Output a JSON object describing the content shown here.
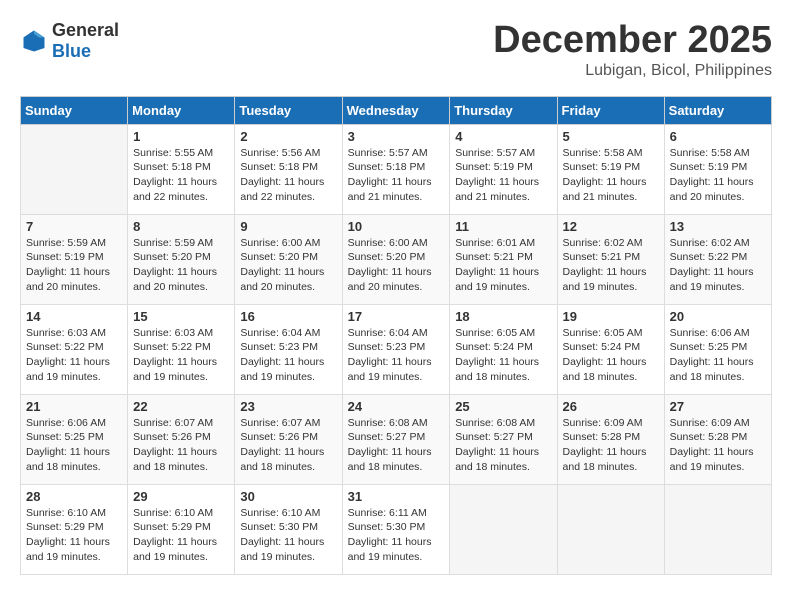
{
  "logo": {
    "general": "General",
    "blue": "Blue"
  },
  "header": {
    "month": "December 2025",
    "location": "Lubigan, Bicol, Philippines"
  },
  "weekdays": [
    "Sunday",
    "Monday",
    "Tuesday",
    "Wednesday",
    "Thursday",
    "Friday",
    "Saturday"
  ],
  "weeks": [
    [
      {
        "day": "",
        "info": ""
      },
      {
        "day": "1",
        "info": "Sunrise: 5:55 AM\nSunset: 5:18 PM\nDaylight: 11 hours\nand 22 minutes."
      },
      {
        "day": "2",
        "info": "Sunrise: 5:56 AM\nSunset: 5:18 PM\nDaylight: 11 hours\nand 22 minutes."
      },
      {
        "day": "3",
        "info": "Sunrise: 5:57 AM\nSunset: 5:18 PM\nDaylight: 11 hours\nand 21 minutes."
      },
      {
        "day": "4",
        "info": "Sunrise: 5:57 AM\nSunset: 5:19 PM\nDaylight: 11 hours\nand 21 minutes."
      },
      {
        "day": "5",
        "info": "Sunrise: 5:58 AM\nSunset: 5:19 PM\nDaylight: 11 hours\nand 21 minutes."
      },
      {
        "day": "6",
        "info": "Sunrise: 5:58 AM\nSunset: 5:19 PM\nDaylight: 11 hours\nand 20 minutes."
      }
    ],
    [
      {
        "day": "7",
        "info": "Sunrise: 5:59 AM\nSunset: 5:19 PM\nDaylight: 11 hours\nand 20 minutes."
      },
      {
        "day": "8",
        "info": "Sunrise: 5:59 AM\nSunset: 5:20 PM\nDaylight: 11 hours\nand 20 minutes."
      },
      {
        "day": "9",
        "info": "Sunrise: 6:00 AM\nSunset: 5:20 PM\nDaylight: 11 hours\nand 20 minutes."
      },
      {
        "day": "10",
        "info": "Sunrise: 6:00 AM\nSunset: 5:20 PM\nDaylight: 11 hours\nand 20 minutes."
      },
      {
        "day": "11",
        "info": "Sunrise: 6:01 AM\nSunset: 5:21 PM\nDaylight: 11 hours\nand 19 minutes."
      },
      {
        "day": "12",
        "info": "Sunrise: 6:02 AM\nSunset: 5:21 PM\nDaylight: 11 hours\nand 19 minutes."
      },
      {
        "day": "13",
        "info": "Sunrise: 6:02 AM\nSunset: 5:22 PM\nDaylight: 11 hours\nand 19 minutes."
      }
    ],
    [
      {
        "day": "14",
        "info": "Sunrise: 6:03 AM\nSunset: 5:22 PM\nDaylight: 11 hours\nand 19 minutes."
      },
      {
        "day": "15",
        "info": "Sunrise: 6:03 AM\nSunset: 5:22 PM\nDaylight: 11 hours\nand 19 minutes."
      },
      {
        "day": "16",
        "info": "Sunrise: 6:04 AM\nSunset: 5:23 PM\nDaylight: 11 hours\nand 19 minutes."
      },
      {
        "day": "17",
        "info": "Sunrise: 6:04 AM\nSunset: 5:23 PM\nDaylight: 11 hours\nand 19 minutes."
      },
      {
        "day": "18",
        "info": "Sunrise: 6:05 AM\nSunset: 5:24 PM\nDaylight: 11 hours\nand 18 minutes."
      },
      {
        "day": "19",
        "info": "Sunrise: 6:05 AM\nSunset: 5:24 PM\nDaylight: 11 hours\nand 18 minutes."
      },
      {
        "day": "20",
        "info": "Sunrise: 6:06 AM\nSunset: 5:25 PM\nDaylight: 11 hours\nand 18 minutes."
      }
    ],
    [
      {
        "day": "21",
        "info": "Sunrise: 6:06 AM\nSunset: 5:25 PM\nDaylight: 11 hours\nand 18 minutes."
      },
      {
        "day": "22",
        "info": "Sunrise: 6:07 AM\nSunset: 5:26 PM\nDaylight: 11 hours\nand 18 minutes."
      },
      {
        "day": "23",
        "info": "Sunrise: 6:07 AM\nSunset: 5:26 PM\nDaylight: 11 hours\nand 18 minutes."
      },
      {
        "day": "24",
        "info": "Sunrise: 6:08 AM\nSunset: 5:27 PM\nDaylight: 11 hours\nand 18 minutes."
      },
      {
        "day": "25",
        "info": "Sunrise: 6:08 AM\nSunset: 5:27 PM\nDaylight: 11 hours\nand 18 minutes."
      },
      {
        "day": "26",
        "info": "Sunrise: 6:09 AM\nSunset: 5:28 PM\nDaylight: 11 hours\nand 18 minutes."
      },
      {
        "day": "27",
        "info": "Sunrise: 6:09 AM\nSunset: 5:28 PM\nDaylight: 11 hours\nand 19 minutes."
      }
    ],
    [
      {
        "day": "28",
        "info": "Sunrise: 6:10 AM\nSunset: 5:29 PM\nDaylight: 11 hours\nand 19 minutes."
      },
      {
        "day": "29",
        "info": "Sunrise: 6:10 AM\nSunset: 5:29 PM\nDaylight: 11 hours\nand 19 minutes."
      },
      {
        "day": "30",
        "info": "Sunrise: 6:10 AM\nSunset: 5:30 PM\nDaylight: 11 hours\nand 19 minutes."
      },
      {
        "day": "31",
        "info": "Sunrise: 6:11 AM\nSunset: 5:30 PM\nDaylight: 11 hours\nand 19 minutes."
      },
      {
        "day": "",
        "info": ""
      },
      {
        "day": "",
        "info": ""
      },
      {
        "day": "",
        "info": ""
      }
    ]
  ]
}
